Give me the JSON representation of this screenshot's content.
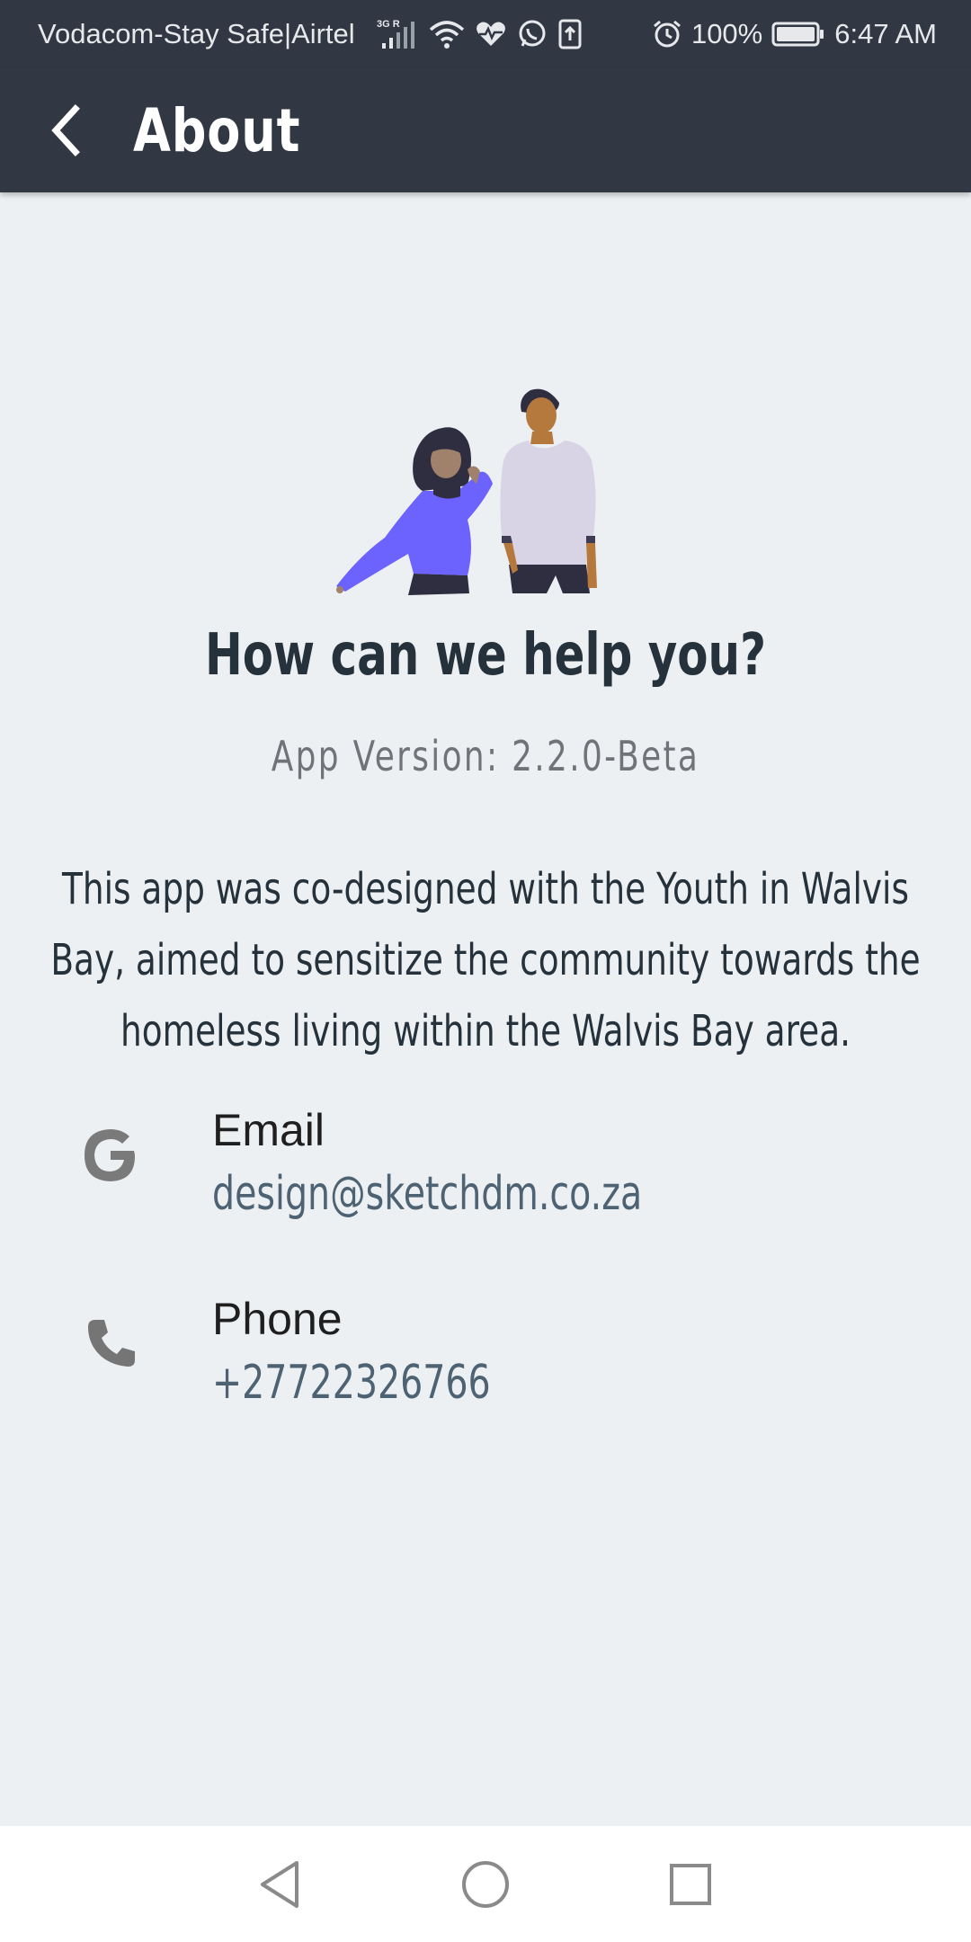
{
  "status_bar": {
    "carrier": "Vodacom-Stay Safe|Airtel",
    "network_badge": "3G R",
    "battery": "100%",
    "time": "6:47 AM",
    "icons": [
      "signal-icon",
      "wifi-icon",
      "health-icon",
      "whatsapp-icon",
      "upload-icon",
      "alarm-icon",
      "battery-icon"
    ]
  },
  "app_bar": {
    "title": "About",
    "back_icon": "back-arrow-icon"
  },
  "main": {
    "heading": "How can we help you?",
    "version": "App Version: 2.2.0-Beta",
    "description": "This app was co-designed with the Youth in Walvis Bay, aimed to sensitize the community towards the homeless living within the Walvis Bay area."
  },
  "contacts": [
    {
      "icon": "google-icon",
      "label": "Email",
      "value": "design@sketchdm.co.za"
    },
    {
      "icon": "phone-icon",
      "label": "Phone",
      "value": "+27722326766"
    }
  ],
  "nav_bar": {
    "buttons": [
      "back-nav-icon",
      "home-nav-icon",
      "recents-nav-icon"
    ]
  },
  "colors": {
    "app_bar": "#313843",
    "background": "#edf0f3",
    "heading": "#26323b",
    "link": "#4d6272",
    "accent_purple": "#6c63ff"
  }
}
